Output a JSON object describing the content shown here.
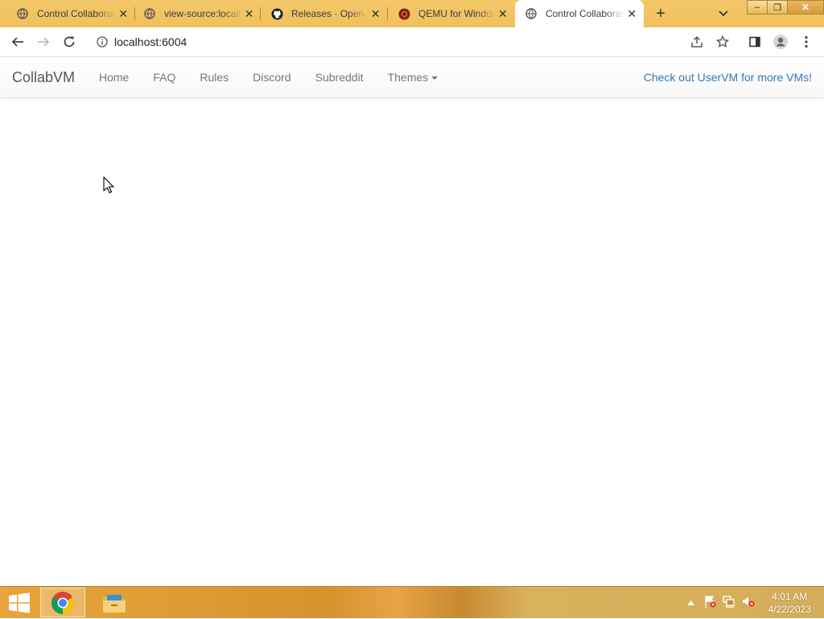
{
  "browser": {
    "tabs": [
      {
        "title": "Control Collaborative",
        "favicon": "globe-icon",
        "active": false
      },
      {
        "title": "view-source:localhost",
        "favicon": "globe-icon",
        "active": false
      },
      {
        "title": "Releases · Open-S",
        "favicon": "github-icon",
        "active": false
      },
      {
        "title": "QEMU for Windows",
        "favicon": "qemu-icon",
        "active": false
      },
      {
        "title": "Control Collaborative",
        "favicon": "globe-icon",
        "active": true
      }
    ],
    "new_tab_label": "+",
    "address": "localhost:6004",
    "window_buttons": {
      "minimize": "–",
      "restore": "❐",
      "close": "✕"
    }
  },
  "page": {
    "navbar": {
      "brand": "CollabVM",
      "links": [
        "Home",
        "FAQ",
        "Rules",
        "Discord",
        "Subreddit"
      ],
      "themes_label": "Themes",
      "promo": "Check out UserVM for more VMs!"
    }
  },
  "taskbar": {
    "apps": [
      "Google Chrome",
      "File Explorer"
    ],
    "clock": {
      "time": "4:01 AM",
      "date": "4/22/2023"
    }
  },
  "colors": {
    "tabstrip": "#f0c05c",
    "link": "#337ab7",
    "navtext": "#777777",
    "taskbar": "#d7922e"
  }
}
